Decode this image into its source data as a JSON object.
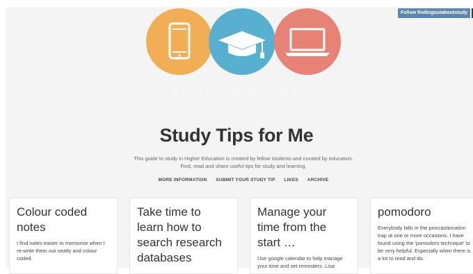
{
  "header": {
    "follow_label": "Follow findingoutaboutstudy",
    "ghost_title": "Learn Library Tools"
  },
  "icons": [
    "phone-icon",
    "graduation-cap-icon",
    "laptop-icon"
  ],
  "colors": {
    "orange": "#f1ae55",
    "blue": "#58b0d1",
    "salmon": "#e78276",
    "follow_button": "#5b86ad"
  },
  "blog": {
    "title": "Study Tips for Me",
    "description_line1": "This guide to study in Higher Education is created by fellow students and curated by educators.",
    "description_line2": "Find, read and share useful tips for study and learning."
  },
  "nav": {
    "more_info": "MORE INFORMATION",
    "submit": "SUBMIT YOUR STUDY TIP",
    "likes": "LIKES",
    "archive": "ARCHIVE"
  },
  "posts": [
    {
      "title": "Colour coded notes",
      "excerpt": "I find notes easier to memorise when I re-write them out neatly and colour coded."
    },
    {
      "title": "Take time to learn how to search research databases",
      "excerpt": ""
    },
    {
      "title": "Manage your time from the start …",
      "excerpt": "Use google calendar to help manage your time and set reminders. Lisa"
    },
    {
      "title": "pomodoro",
      "excerpt": "Everybody falls in the procrastionation trap at one or more occasions. I have found using the 'pomodoro technique' to be very helpful. Especially when there is a lot to read and do."
    }
  ]
}
